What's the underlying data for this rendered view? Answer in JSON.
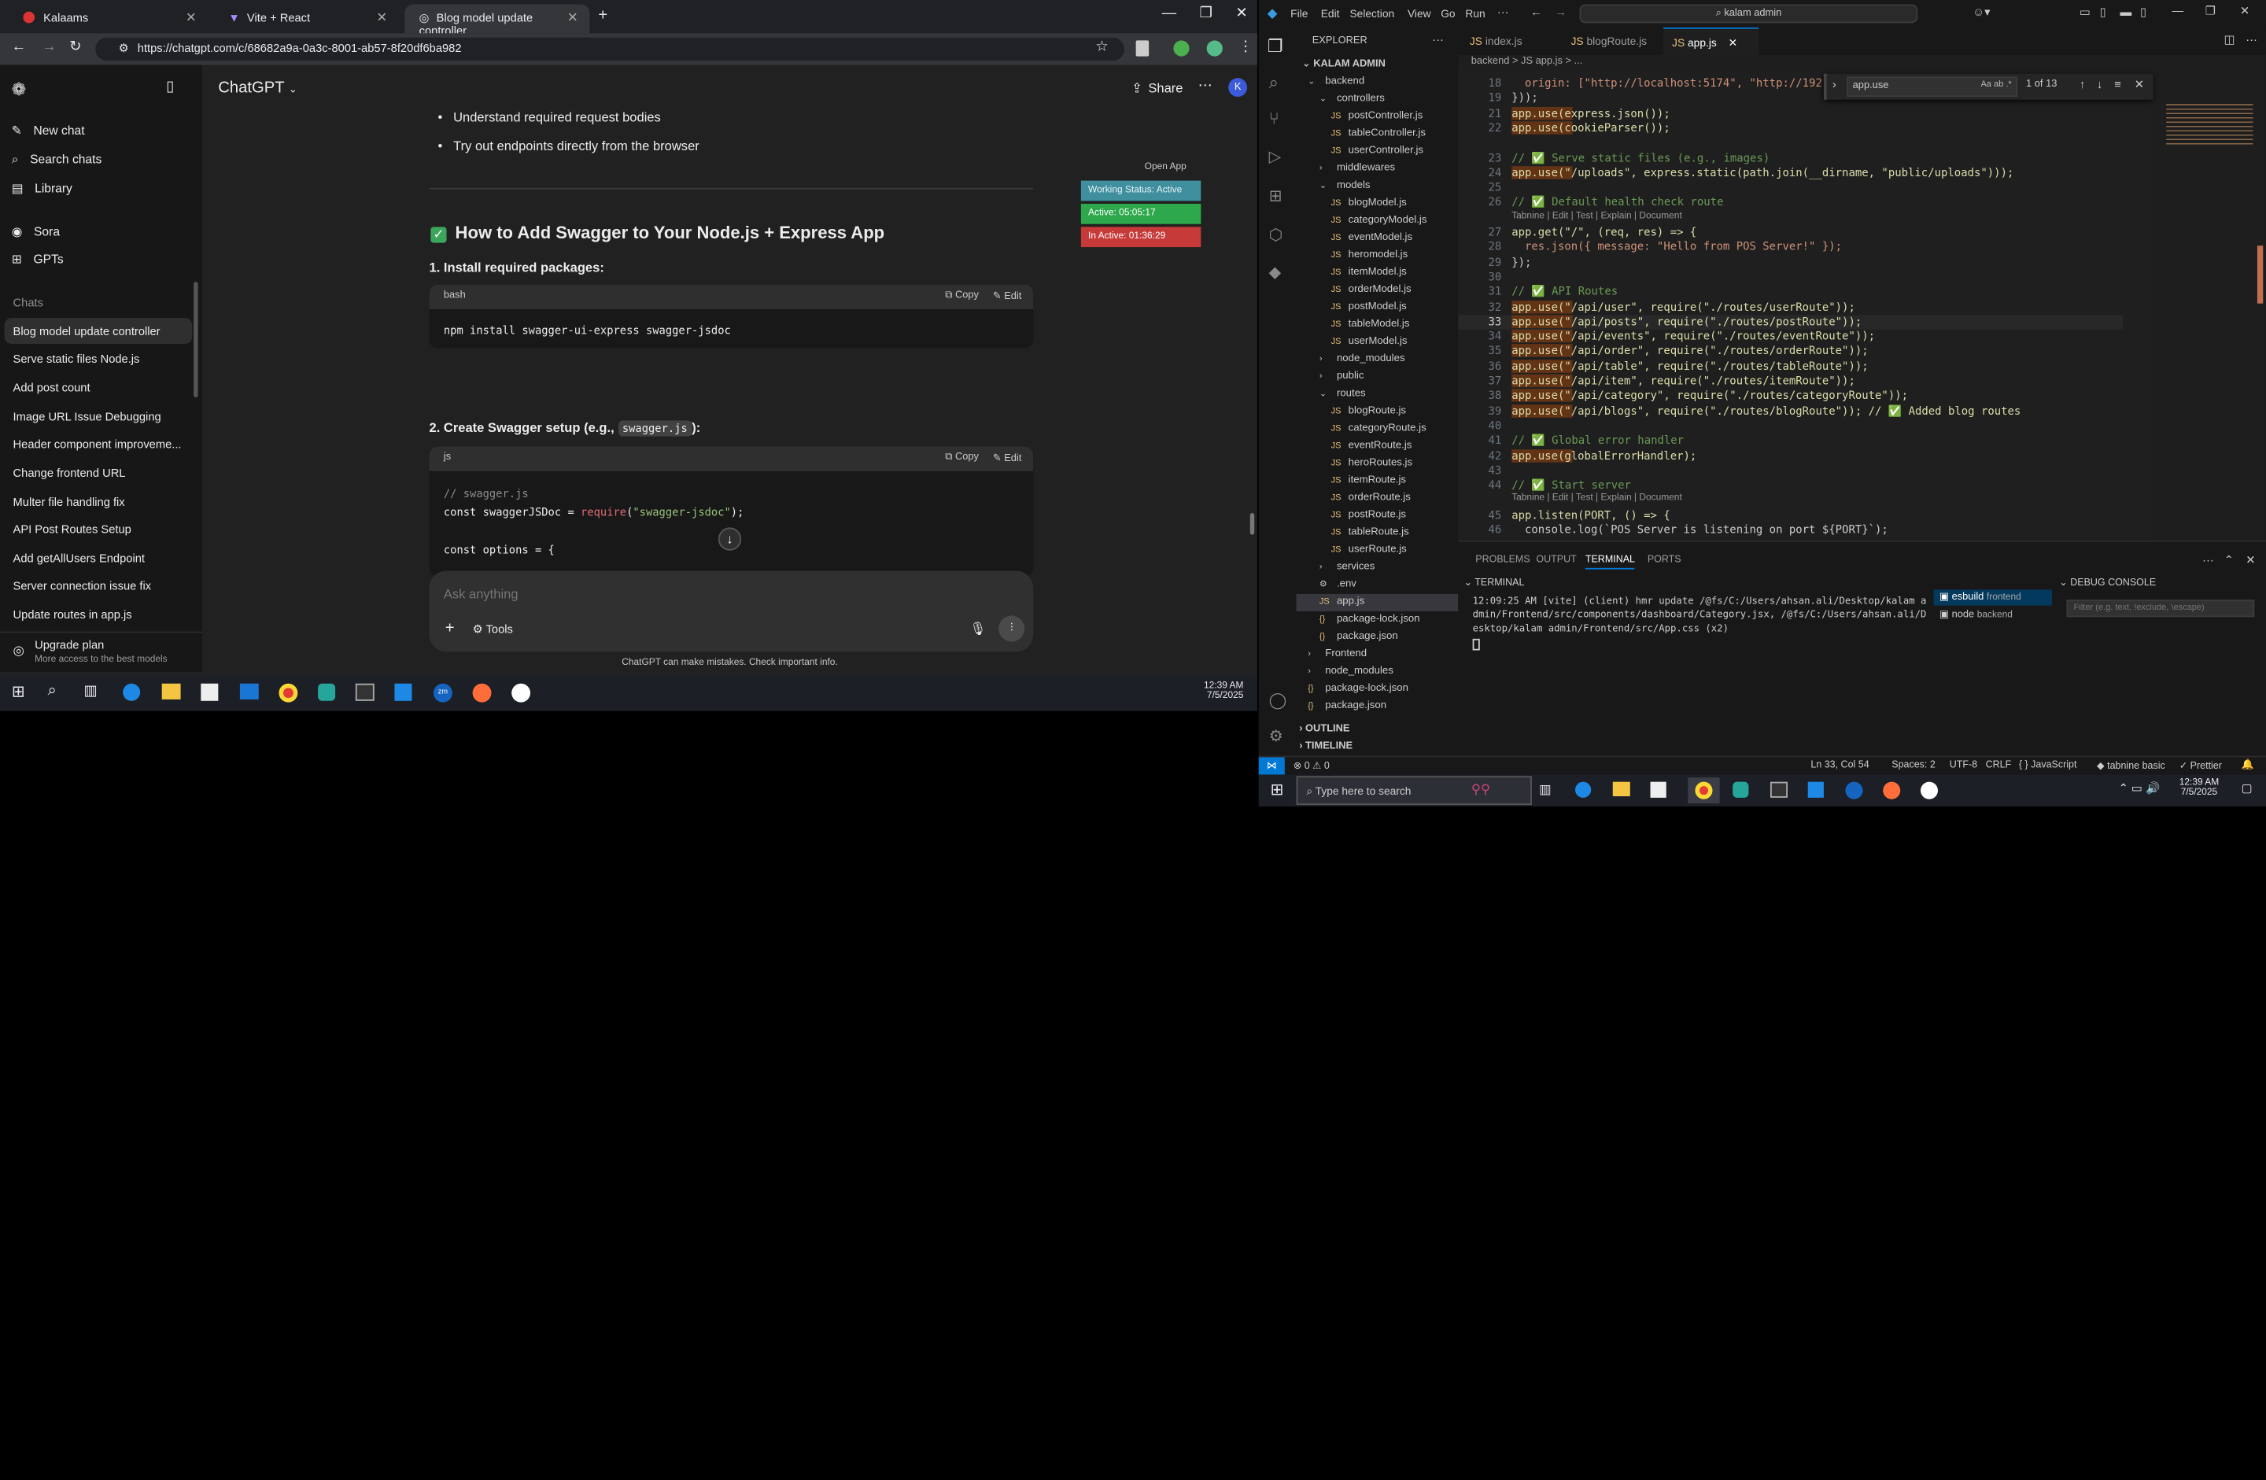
{
  "browser": {
    "tabs": [
      {
        "label": "Kalaams"
      },
      {
        "label": "Vite + React"
      },
      {
        "label": "Blog model update controller"
      }
    ],
    "url": "https://chatgpt.com/c/68682a9a-0a3c-8001-ab57-8f20df6ba982"
  },
  "chatgpt": {
    "sidebar": {
      "new_chat": "New chat",
      "search": "Search chats",
      "library": "Library",
      "sora": "Sora",
      "gpts": "GPTs",
      "chats_heading": "Chats",
      "chats": [
        "Blog model update controller",
        "Serve static files Node.js",
        "Add post count",
        "Image URL Issue Debugging",
        "Header component improveme...",
        "Change frontend URL",
        "Multer file handling fix",
        "API Post Routes Setup",
        "Add getAllUsers Endpoint",
        "Server connection issue fix",
        "Update routes in app.js"
      ],
      "upgrade_title": "Upgrade plan",
      "upgrade_sub": "More access to the best models"
    },
    "header": {
      "model": "ChatGPT",
      "share": "Share"
    },
    "content": {
      "bullets": [
        "Understand required request bodies",
        "Try out endpoints directly from the browser"
      ],
      "section_title": "How to Add Swagger to Your Node.js + Express App",
      "step1": "1. Install required packages:",
      "code1_lang": "bash",
      "code1": "npm install swagger-ui-express swagger-jsdoc",
      "copy": "Copy",
      "edit": "Edit",
      "step2_prefix": "2. Create Swagger setup (e.g.,",
      "step2_code": "swagger.js",
      "step2_suffix": "):",
      "code2_lang": "js",
      "code2_l1": "// swagger.js",
      "code2_l2a": "const swaggerJSDoc = ",
      "code2_l2b": "require",
      "code2_l2c": "(",
      "code2_l2d": "\"swagger-jsdoc\"",
      "code2_l2e": ");",
      "code2_l3": "const options = {",
      "open_app": "Open App",
      "status_working": "Working Status: Active",
      "status_active": "Active: 05:05:17",
      "status_inactive": "In Active: 01:36:29"
    },
    "composer": {
      "placeholder": "Ask anything",
      "tools": "Tools"
    },
    "footer": "ChatGPT can make mistakes. Check important info."
  },
  "left_taskbar": {
    "time": "12:39 AM",
    "date": "7/5/2025"
  },
  "vscode": {
    "menu": [
      "File",
      "Edit",
      "Selection",
      "View",
      "Go",
      "Run"
    ],
    "search": "kalam admin",
    "explorer_title": "EXPLORER",
    "root": "KALAM ADMIN",
    "tree": [
      {
        "label": "backend",
        "kind": "folder-open",
        "indent": 1
      },
      {
        "label": "controllers",
        "kind": "folder-open",
        "indent": 2
      },
      {
        "label": "postController.js",
        "kind": "js",
        "indent": 3
      },
      {
        "label": "tableController.js",
        "kind": "js",
        "indent": 3
      },
      {
        "label": "userController.js",
        "kind": "js",
        "indent": 3
      },
      {
        "label": "middlewares",
        "kind": "folder",
        "indent": 2
      },
      {
        "label": "models",
        "kind": "folder-open",
        "indent": 2
      },
      {
        "label": "blogModel.js",
        "kind": "js",
        "indent": 3
      },
      {
        "label": "categoryModel.js",
        "kind": "js",
        "indent": 3
      },
      {
        "label": "eventModel.js",
        "kind": "js",
        "indent": 3
      },
      {
        "label": "heromodel.js",
        "kind": "js",
        "indent": 3
      },
      {
        "label": "itemModel.js",
        "kind": "js",
        "indent": 3
      },
      {
        "label": "orderModel.js",
        "kind": "js",
        "indent": 3
      },
      {
        "label": "postModel.js",
        "kind": "js",
        "indent": 3
      },
      {
        "label": "tableModel.js",
        "kind": "js",
        "indent": 3
      },
      {
        "label": "userModel.js",
        "kind": "js",
        "indent": 3
      },
      {
        "label": "node_modules",
        "kind": "folder",
        "indent": 2
      },
      {
        "label": "public",
        "kind": "folder",
        "indent": 2
      },
      {
        "label": "routes",
        "kind": "folder-open",
        "indent": 2
      },
      {
        "label": "blogRoute.js",
        "kind": "js",
        "indent": 3
      },
      {
        "label": "categoryRoute.js",
        "kind": "js",
        "indent": 3
      },
      {
        "label": "eventRoute.js",
        "kind": "js",
        "indent": 3
      },
      {
        "label": "heroRoutes.js",
        "kind": "js",
        "indent": 3
      },
      {
        "label": "itemRoute.js",
        "kind": "js",
        "indent": 3
      },
      {
        "label": "orderRoute.js",
        "kind": "js",
        "indent": 3
      },
      {
        "label": "postRoute.js",
        "kind": "js",
        "indent": 3
      },
      {
        "label": "tableRoute.js",
        "kind": "js",
        "indent": 3
      },
      {
        "label": "userRoute.js",
        "kind": "js",
        "indent": 3
      },
      {
        "label": "services",
        "kind": "folder",
        "indent": 2
      },
      {
        "label": ".env",
        "kind": "env",
        "indent": 2
      },
      {
        "label": "app.js",
        "kind": "js",
        "indent": 2
      },
      {
        "label": "package-lock.json",
        "kind": "json",
        "indent": 2
      },
      {
        "label": "package.json",
        "kind": "json",
        "indent": 2
      },
      {
        "label": "Frontend",
        "kind": "folder",
        "indent": 1
      },
      {
        "label": "node_modules",
        "kind": "folder",
        "indent": 1
      },
      {
        "label": "package-lock.json",
        "kind": "json",
        "indent": 1
      },
      {
        "label": "package.json",
        "kind": "json",
        "indent": 1
      }
    ],
    "outline": "OUTLINE",
    "timeline": "TIMELINE",
    "editor_tabs": [
      "index.js",
      "blogRoute.js",
      "app.js"
    ],
    "breadcrumb": "backend > JS app.js > ...",
    "find_value": "app.use",
    "find_count": "1 of 13",
    "code_lines": [
      {
        "n": "18",
        "t": "  origin: [\"http://localhost:5174\", \"http://192.168"
      },
      {
        "n": "19",
        "t": "}));"
      },
      {
        "n": "21",
        "t": "app.use(express.json());"
      },
      {
        "n": "22",
        "t": "app.use(cookieParser());"
      },
      {
        "n": "",
        "t": ""
      },
      {
        "n": "23",
        "t": "// ✅ Serve static files (e.g., images)"
      },
      {
        "n": "24",
        "t": "app.use(\"/uploads\", express.static(path.join(__dirname, \"public/uploads\")));"
      },
      {
        "n": "25",
        "t": ""
      },
      {
        "n": "26",
        "t": "// ✅ Default health check route"
      },
      {
        "n": "",
        "t": "Tabnine | Edit | Test | Explain | Document"
      },
      {
        "n": "27",
        "t": "app.get(\"/\", (req, res) => {"
      },
      {
        "n": "28",
        "t": "  res.json({ message: \"Hello from POS Server!\" });"
      },
      {
        "n": "29",
        "t": "});"
      },
      {
        "n": "30",
        "t": ""
      },
      {
        "n": "31",
        "t": "// ✅ API Routes"
      },
      {
        "n": "32",
        "t": "app.use(\"/api/user\", require(\"./routes/userRoute\"));"
      },
      {
        "n": "33",
        "t": "app.use(\"/api/posts\", require(\"./routes/postRoute\"));"
      },
      {
        "n": "34",
        "t": "app.use(\"/api/events\", require(\"./routes/eventRoute\"));"
      },
      {
        "n": "35",
        "t": "app.use(\"/api/order\", require(\"./routes/orderRoute\"));"
      },
      {
        "n": "36",
        "t": "app.use(\"/api/table\", require(\"./routes/tableRoute\"));"
      },
      {
        "n": "37",
        "t": "app.use(\"/api/item\", require(\"./routes/itemRoute\"));"
      },
      {
        "n": "38",
        "t": "app.use(\"/api/category\", require(\"./routes/categoryRoute\"));"
      },
      {
        "n": "39",
        "t": "app.use(\"/api/blogs\", require(\"./routes/blogRoute\")); // ✅ Added blog routes"
      },
      {
        "n": "40",
        "t": ""
      },
      {
        "n": "41",
        "t": "// ✅ Global error handler"
      },
      {
        "n": "42",
        "t": "app.use(globalErrorHandler);"
      },
      {
        "n": "43",
        "t": ""
      },
      {
        "n": "44",
        "t": "// ✅ Start server"
      },
      {
        "n": "",
        "t": "Tabnine | Edit | Test | Explain | Document"
      },
      {
        "n": "45",
        "t": "app.listen(PORT, () => {"
      },
      {
        "n": "46",
        "t": "  console.log(`POS Server is listening on port ${PORT}`);"
      }
    ],
    "panel_tabs": [
      "PROBLEMS",
      "OUTPUT",
      "TERMINAL",
      "PORTS"
    ],
    "terminal_title": "TERMINAL",
    "terminal_text": "12:09:25 AM [vite] (client) hmr update /@fs/C:/Users/ahsan.ali/Desktop/kalam admin/Frontend/src/components/dashboard/Category.jsx, /@fs/C:/Users/ahsan.ali/Desktop/kalam admin/Frontend/src/App.css (x2)",
    "terminals": [
      {
        "name": "esbuild",
        "sub": "frontend"
      },
      {
        "name": "node",
        "sub": "backend"
      }
    ],
    "debug_title": "DEBUG CONSOLE",
    "debug_filter": "Filter (e.g. text, !exclude, \\escape)",
    "status": {
      "errors": "⊗ 0 ⚠ 0",
      "pos": "Ln 33, Col 54",
      "spaces": "Spaces: 2",
      "enc": "UTF-8",
      "eol": "CRLF",
      "lang": "{ } JavaScript",
      "tabnine": "tabnine basic",
      "prettier": "✓ Prettier"
    }
  },
  "right_taskbar": {
    "search": "Type here to search",
    "time": "12:39 AM",
    "date": "7/5/2025"
  }
}
